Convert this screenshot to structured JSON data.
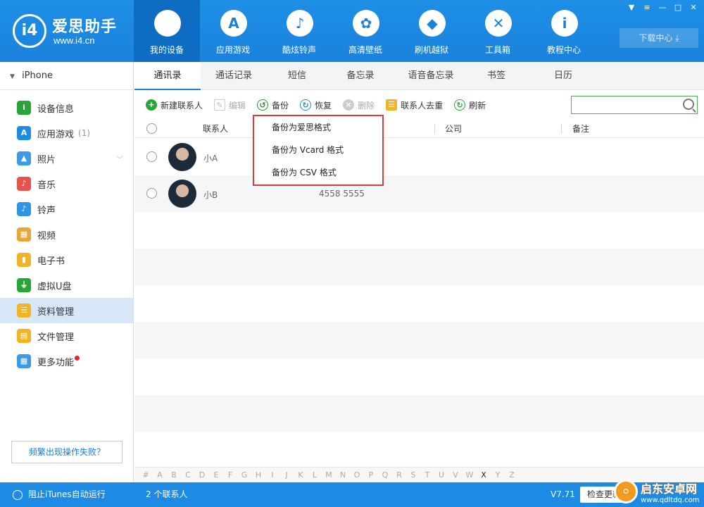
{
  "app": {
    "logo_text": "爱思助手",
    "logo_mark": "i4",
    "logo_url": "www.i4.cn"
  },
  "nav": [
    {
      "label": "我的设备",
      "icon": "apple-icon",
      "glyph": "",
      "active": true
    },
    {
      "label": "应用游戏",
      "icon": "app-store-icon",
      "glyph": "A"
    },
    {
      "label": "酷炫铃声",
      "icon": "bell-icon",
      "glyph": "♪"
    },
    {
      "label": "高清壁纸",
      "icon": "flower-icon",
      "glyph": "✿"
    },
    {
      "label": "刷机越狱",
      "icon": "box-icon",
      "glyph": "◆"
    },
    {
      "label": "工具箱",
      "icon": "tools-icon",
      "glyph": "✕"
    },
    {
      "label": "教程中心",
      "icon": "info-icon",
      "glyph": "i"
    }
  ],
  "window_buttons": [
    "shirt-icon",
    "menu-icon",
    "minimize-icon",
    "maximize-icon",
    "close-icon"
  ],
  "download_center": "下载中心",
  "sidebar": {
    "device_name": "iPhone",
    "items": [
      {
        "label": "设备信息",
        "icon": "info-icon",
        "color": "#27a537",
        "glyph": "i"
      },
      {
        "label": "应用游戏",
        "icon": "app-store-icon",
        "color": "#1d8ae3",
        "glyph": "A",
        "count": "(1)"
      },
      {
        "label": "照片",
        "icon": "photo-icon",
        "color": "#3d9ae8",
        "glyph": "▲",
        "chevron": true
      },
      {
        "label": "音乐",
        "icon": "music-icon",
        "color": "#e8524a",
        "glyph": "♪"
      },
      {
        "label": "铃声",
        "icon": "bell-icon",
        "color": "#2b95e8",
        "glyph": "♪"
      },
      {
        "label": "视频",
        "icon": "video-icon",
        "color": "#e3a63a",
        "glyph": "▦"
      },
      {
        "label": "电子书",
        "icon": "book-icon",
        "color": "#f0b429",
        "glyph": "▮"
      },
      {
        "label": "虚拟U盘",
        "icon": "usb-icon",
        "color": "#27a537",
        "glyph": "⏚"
      },
      {
        "label": "资料管理",
        "icon": "contacts-icon",
        "color": "#f0b429",
        "glyph": "☰",
        "active": true
      },
      {
        "label": "文件管理",
        "icon": "file-icon",
        "color": "#f0b429",
        "glyph": "▤"
      },
      {
        "label": "更多功能",
        "icon": "grid-icon",
        "color": "#3d9ae8",
        "glyph": "▦",
        "dot": true
      }
    ],
    "fail_button": "频繁出现操作失败？"
  },
  "tabs": [
    "通讯录",
    "通话记录",
    "短信",
    "备忘录",
    "语音备忘录",
    "书签",
    "日历"
  ],
  "toolbar": {
    "new_contact": "新建联系人",
    "edit": "编辑",
    "backup": "备份",
    "restore": "恢复",
    "delete": "删除",
    "dedupe": "联系人去重",
    "refresh": "刷新",
    "search_placeholder": ""
  },
  "table": {
    "headers": {
      "name": "联系人",
      "company": "公司",
      "note": "备注"
    },
    "rows": [
      {
        "name": "小A",
        "phone": ""
      },
      {
        "name": "小B",
        "phone": "4558 5555"
      }
    ]
  },
  "backup_menu": [
    "备份为爱思格式",
    "备份为 Vcard 格式",
    "备份为 CSV 格式"
  ],
  "alphabet": [
    "#",
    "A",
    "B",
    "C",
    "D",
    "E",
    "F",
    "G",
    "H",
    "I",
    "J",
    "K",
    "L",
    "M",
    "N",
    "O",
    "P",
    "Q",
    "R",
    "S",
    "T",
    "U",
    "V",
    "W",
    "X",
    "Y",
    "Z"
  ],
  "alphabet_active": "X",
  "status": {
    "itunes": "阻止iTunes自动运行",
    "count": "2 个联系人",
    "version": "V7.71",
    "check_update": "检查更新"
  },
  "watermark": {
    "title": "启东安卓网",
    "url": "www.qdltdq.com"
  }
}
